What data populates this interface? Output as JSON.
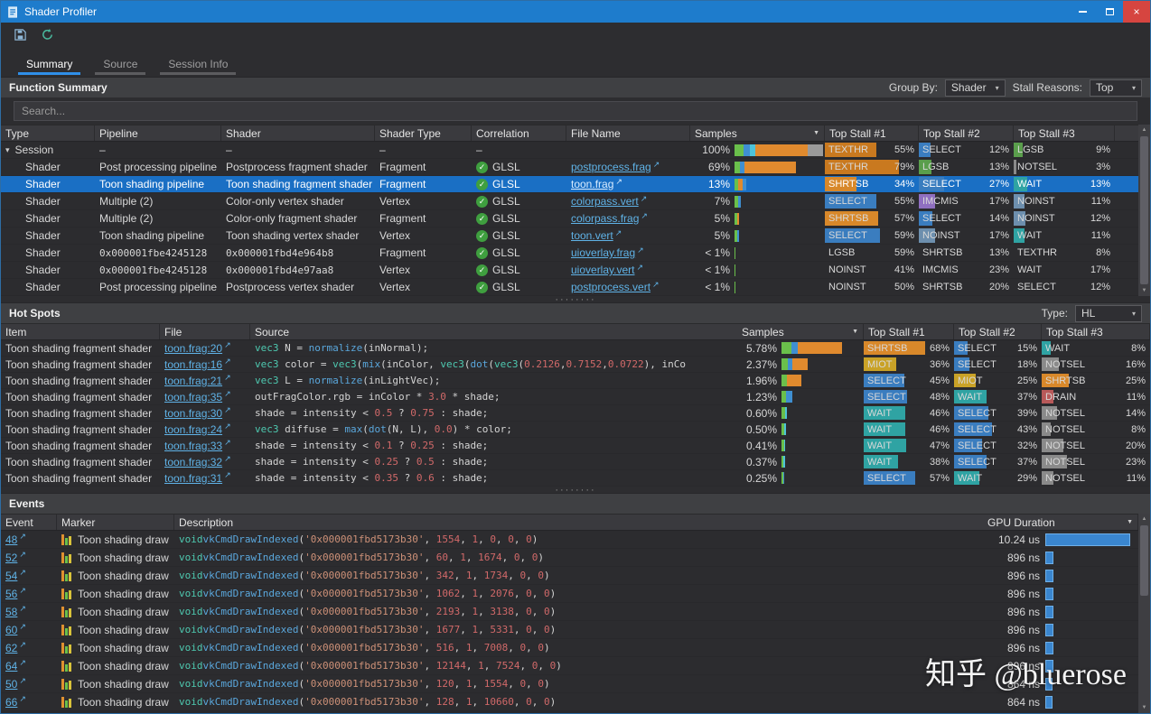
{
  "window": {
    "title": "Shader Profiler"
  },
  "icons": {
    "close": "×",
    "dropdown": "▾",
    "expander": "▾",
    "sort": "▼",
    "external": "↗",
    "check": "✓",
    "scroll_up": "▲",
    "scroll_down": "▼",
    "grip": "········"
  },
  "tabs": [
    {
      "label": "Summary"
    },
    {
      "label": "Source"
    },
    {
      "label": "Session Info"
    }
  ],
  "stall_colors": {
    "TEXTHR": "#c9791f",
    "SHRTSB": "#d8882a",
    "SELECT": "#3a7dbf",
    "LGSB": "#5a9e4c",
    "WAIT": "#2fa3a3",
    "MIOT": "#c9a227",
    "IMCMIS": "#8f6fc0",
    "NOINST": "#6d8fae",
    "NOTSEL": "#8a8a8a",
    "DRAIN": "#b85959"
  },
  "function_summary": {
    "title": "Function Summary",
    "group_by_label": "Group By:",
    "group_by_value": "Shader",
    "stall_reasons_label": "Stall Reasons:",
    "stall_reasons_value": "Top",
    "search_placeholder": "Search...",
    "columns": [
      "Type",
      "Pipeline",
      "Shader",
      "Shader Type",
      "Correlation",
      "File Name",
      "Samples",
      "Top Stall #1",
      "Top Stall #2",
      "Top Stall #3"
    ],
    "rows": [
      {
        "type": "Session",
        "expander": true,
        "pipeline": "–",
        "shader": "–",
        "shader_type": "–",
        "correlation": "–",
        "file": null,
        "samples": "100%",
        "bar": [
          [
            "#6abf4b",
            10
          ],
          [
            "#3f8fd1",
            7
          ],
          [
            "#4dc3d9",
            6
          ],
          [
            "#e08a2e",
            60
          ],
          [
            "#9a9a9a",
            17
          ]
        ],
        "stalls": [
          {
            "name": "TEXTHR",
            "pct": "55%",
            "w": 55
          },
          {
            "name": "SELECT",
            "pct": "12%",
            "w": 12
          },
          {
            "name": "LGSB",
            "pct": "9%",
            "w": 9
          }
        ]
      },
      {
        "type": "Shader",
        "pipeline": "Post processing pipeline",
        "shader": "Postprocess fragment shader",
        "shader_type": "Fragment",
        "correlation": "GLSL",
        "file": "postprocess.frag",
        "samples": "69%",
        "bar": [
          [
            "#6abf4b",
            6
          ],
          [
            "#3f8fd1",
            5
          ],
          [
            "#e08a2e",
            58
          ]
        ],
        "stalls": [
          {
            "name": "TEXTHR",
            "pct": "79%",
            "w": 79
          },
          {
            "name": "LGSB",
            "pct": "13%",
            "w": 13
          },
          {
            "name": "NOTSEL",
            "pct": "3%",
            "w": 3
          }
        ]
      },
      {
        "type": "Shader",
        "selected": true,
        "pipeline": "Toon shading pipeline",
        "shader": "Toon shading fragment shader",
        "shader_type": "Fragment",
        "correlation": "GLSL",
        "file": "toon.frag",
        "samples": "13%",
        "bar": [
          [
            "#6abf4b",
            4
          ],
          [
            "#e08a2e",
            5
          ],
          [
            "#3f8fd1",
            4
          ]
        ],
        "stalls": [
          {
            "name": "SHRTSB",
            "pct": "34%",
            "w": 34
          },
          {
            "name": "SELECT",
            "pct": "27%",
            "w": 27
          },
          {
            "name": "WAIT",
            "pct": "13%",
            "w": 13
          }
        ]
      },
      {
        "type": "Shader",
        "pipeline": "Multiple (2)",
        "shader": "Color-only vertex shader",
        "shader_type": "Vertex",
        "correlation": "GLSL",
        "file": "colorpass.vert",
        "samples": "7%",
        "bar": [
          [
            "#6abf4b",
            4
          ],
          [
            "#3f8fd1",
            3
          ]
        ],
        "stalls": [
          {
            "name": "SELECT",
            "pct": "55%",
            "w": 55
          },
          {
            "name": "IMCMIS",
            "pct": "17%",
            "w": 17
          },
          {
            "name": "NOINST",
            "pct": "11%",
            "w": 11
          }
        ]
      },
      {
        "type": "Shader",
        "pipeline": "Multiple (2)",
        "shader": "Color-only fragment shader",
        "shader_type": "Fragment",
        "correlation": "GLSL",
        "file": "colorpass.frag",
        "samples": "5%",
        "bar": [
          [
            "#6abf4b",
            3
          ],
          [
            "#e08a2e",
            2
          ]
        ],
        "stalls": [
          {
            "name": "SHRTSB",
            "pct": "57%",
            "w": 57
          },
          {
            "name": "SELECT",
            "pct": "14%",
            "w": 14
          },
          {
            "name": "NOINST",
            "pct": "12%",
            "w": 12
          }
        ]
      },
      {
        "type": "Shader",
        "pipeline": "Toon shading pipeline",
        "shader": "Toon shading vertex shader",
        "shader_type": "Vertex",
        "correlation": "GLSL",
        "file": "toon.vert",
        "samples": "5%",
        "bar": [
          [
            "#6abf4b",
            3
          ],
          [
            "#3f8fd1",
            2
          ]
        ],
        "stalls": [
          {
            "name": "SELECT",
            "pct": "59%",
            "w": 59
          },
          {
            "name": "NOINST",
            "pct": "17%",
            "w": 17
          },
          {
            "name": "WAIT",
            "pct": "11%",
            "w": 11
          }
        ]
      },
      {
        "type": "Shader",
        "pipeline": "0x000001fbe4245128",
        "shader": "0x000001fbd4e964b8",
        "shader_type": "Fragment",
        "correlation": "GLSL",
        "file": "uioverlay.frag",
        "samples": "< 1%",
        "bar": [
          [
            "#6abf4b",
            1
          ]
        ],
        "stalls": [
          {
            "name": "LGSB",
            "pct": "59%",
            "w": 0
          },
          {
            "name": "SHRTSB",
            "pct": "13%",
            "w": 0
          },
          {
            "name": "TEXTHR",
            "pct": "8%",
            "w": 0
          }
        ]
      },
      {
        "type": "Shader",
        "pipeline": "0x000001fbe4245128",
        "shader": "0x000001fbd4e97aa8",
        "shader_type": "Vertex",
        "correlation": "GLSL",
        "file": "uioverlay.vert",
        "samples": "< 1%",
        "bar": [
          [
            "#6abf4b",
            1
          ]
        ],
        "stalls": [
          {
            "name": "NOINST",
            "pct": "41%",
            "w": 0
          },
          {
            "name": "IMCMIS",
            "pct": "23%",
            "w": 0
          },
          {
            "name": "WAIT",
            "pct": "17%",
            "w": 0
          }
        ]
      },
      {
        "type": "Shader",
        "pipeline": "Post processing pipeline",
        "shader": "Postprocess vertex shader",
        "shader_type": "Vertex",
        "correlation": "GLSL",
        "file": "postprocess.vert",
        "samples": "< 1%",
        "bar": [
          [
            "#6abf4b",
            1
          ]
        ],
        "stalls": [
          {
            "name": "NOINST",
            "pct": "50%",
            "w": 0
          },
          {
            "name": "SHRTSB",
            "pct": "20%",
            "w": 0
          },
          {
            "name": "SELECT",
            "pct": "12%",
            "w": 0
          }
        ]
      }
    ]
  },
  "hot_spots": {
    "title": "Hot Spots",
    "type_label": "Type:",
    "type_value": "HL",
    "columns": [
      "Item",
      "File",
      "Source",
      "Samples",
      "Top Stall #1",
      "Top Stall #2",
      "Top Stall #3"
    ],
    "rows": [
      {
        "item": "Toon shading fragment shader",
        "file": "toon.frag:20",
        "source": "vec3 N = normalize(inNormal);",
        "samples": "5.78%",
        "bar": [
          [
            "#6abf4b",
            12
          ],
          [
            "#3f8fd1",
            8
          ],
          [
            "#e08a2e",
            55
          ]
        ],
        "stalls": [
          {
            "name": "SHRTSB",
            "pct": "68%",
            "w": 68
          },
          {
            "name": "SELECT",
            "pct": "15%",
            "w": 15
          },
          {
            "name": "WAIT",
            "pct": "8%",
            "w": 8
          }
        ]
      },
      {
        "item": "Toon shading fragment shader",
        "file": "toon.frag:16",
        "source": "vec3 color = vec3(mix(inColor, vec3(dot(vec3(0.2126,0.7152,0.0722), inCo",
        "samples": "2.37%",
        "bar": [
          [
            "#6abf4b",
            8
          ],
          [
            "#3f8fd1",
            5
          ],
          [
            "#e08a2e",
            20
          ]
        ],
        "stalls": [
          {
            "name": "MIOT",
            "pct": "36%",
            "w": 36
          },
          {
            "name": "SELECT",
            "pct": "18%",
            "w": 18
          },
          {
            "name": "NOTSEL",
            "pct": "16%",
            "w": 16
          }
        ]
      },
      {
        "item": "Toon shading fragment shader",
        "file": "toon.frag:21",
        "source": "vec3 L = normalize(inLightVec);",
        "samples": "1.96%",
        "bar": [
          [
            "#6abf4b",
            7
          ],
          [
            "#e08a2e",
            18
          ]
        ],
        "stalls": [
          {
            "name": "SELECT",
            "pct": "45%",
            "w": 45
          },
          {
            "name": "MIOT",
            "pct": "25%",
            "w": 25
          },
          {
            "name": "SHRTSB",
            "pct": "25%",
            "w": 25
          }
        ]
      },
      {
        "item": "Toon shading fragment shader",
        "file": "toon.frag:35",
        "source": "outFragColor.rgb = inColor * 3.0 * shade;",
        "samples": "1.23%",
        "bar": [
          [
            "#6abf4b",
            6
          ],
          [
            "#3f8fd1",
            8
          ]
        ],
        "stalls": [
          {
            "name": "SELECT",
            "pct": "48%",
            "w": 48
          },
          {
            "name": "WAIT",
            "pct": "37%",
            "w": 37
          },
          {
            "name": "DRAIN",
            "pct": "11%",
            "w": 11
          }
        ]
      },
      {
        "item": "Toon shading fragment shader",
        "file": "toon.frag:30",
        "source": "shade = intensity < 0.5 ? 0.75 : shade;",
        "samples": "0.60%",
        "bar": [
          [
            "#6abf4b",
            4
          ],
          [
            "#4dc3d9",
            3
          ]
        ],
        "stalls": [
          {
            "name": "WAIT",
            "pct": "46%",
            "w": 46
          },
          {
            "name": "SELECT",
            "pct": "39%",
            "w": 39
          },
          {
            "name": "NOTSEL",
            "pct": "14%",
            "w": 14
          }
        ]
      },
      {
        "item": "Toon shading fragment shader",
        "file": "toon.frag:24",
        "source": "vec3 diffuse = max(dot(N, L), 0.0) * color;",
        "samples": "0.50%",
        "bar": [
          [
            "#6abf4b",
            3
          ],
          [
            "#4dc3d9",
            3
          ]
        ],
        "stalls": [
          {
            "name": "WAIT",
            "pct": "46%",
            "w": 46
          },
          {
            "name": "SELECT",
            "pct": "43%",
            "w": 43
          },
          {
            "name": "NOTSEL",
            "pct": "8%",
            "w": 8
          }
        ]
      },
      {
        "item": "Toon shading fragment shader",
        "file": "toon.frag:33",
        "source": "shade = intensity < 0.1 ? 0.25 : shade;",
        "samples": "0.41%",
        "bar": [
          [
            "#6abf4b",
            3
          ],
          [
            "#4dc3d9",
            2
          ]
        ],
        "stalls": [
          {
            "name": "WAIT",
            "pct": "47%",
            "w": 47
          },
          {
            "name": "SELECT",
            "pct": "32%",
            "w": 32
          },
          {
            "name": "NOTSEL",
            "pct": "20%",
            "w": 20
          }
        ]
      },
      {
        "item": "Toon shading fragment shader",
        "file": "toon.frag:32",
        "source": "shade = intensity < 0.25 ? 0.5 : shade;",
        "samples": "0.37%",
        "bar": [
          [
            "#6abf4b",
            2
          ],
          [
            "#4dc3d9",
            2
          ]
        ],
        "stalls": [
          {
            "name": "WAIT",
            "pct": "38%",
            "w": 38
          },
          {
            "name": "SELECT",
            "pct": "37%",
            "w": 37
          },
          {
            "name": "NOTSEL",
            "pct": "23%",
            "w": 23
          }
        ]
      },
      {
        "item": "Toon shading fragment shader",
        "file": "toon.frag:31",
        "source": "shade = intensity < 0.35 ? 0.6 : shade;",
        "samples": "0.25%",
        "bar": [
          [
            "#6abf4b",
            2
          ],
          [
            "#3f8fd1",
            1
          ]
        ],
        "stalls": [
          {
            "name": "SELECT",
            "pct": "57%",
            "w": 57
          },
          {
            "name": "WAIT",
            "pct": "29%",
            "w": 29
          },
          {
            "name": "NOTSEL",
            "pct": "11%",
            "w": 11
          }
        ]
      }
    ]
  },
  "events": {
    "title": "Events",
    "columns": [
      "Event",
      "Marker",
      "Description",
      "GPU Duration"
    ],
    "marker_colors": [
      "#e0912f",
      "#6abf4b",
      "#d9c33a"
    ],
    "gpu_bar_color": "#3a86cf",
    "rows": [
      {
        "event": "48",
        "marker": "Toon shading draw",
        "description": "void vkCmdDrawIndexed('0x000001fbd5173b30', 1554, 1, 0, 0, 0)",
        "duration": "10.24 us",
        "bar": 96
      },
      {
        "event": "52",
        "marker": "Toon shading draw",
        "description": "void vkCmdDrawIndexed('0x000001fbd5173b30', 60, 1, 1674, 0, 0)",
        "duration": "896 ns",
        "bar": 9
      },
      {
        "event": "54",
        "marker": "Toon shading draw",
        "description": "void vkCmdDrawIndexed('0x000001fbd5173b30', 342, 1, 1734, 0, 0)",
        "duration": "896 ns",
        "bar": 9
      },
      {
        "event": "56",
        "marker": "Toon shading draw",
        "description": "void vkCmdDrawIndexed('0x000001fbd5173b30', 1062, 1, 2076, 0, 0)",
        "duration": "896 ns",
        "bar": 9
      },
      {
        "event": "58",
        "marker": "Toon shading draw",
        "description": "void vkCmdDrawIndexed('0x000001fbd5173b30', 2193, 1, 3138, 0, 0)",
        "duration": "896 ns",
        "bar": 9
      },
      {
        "event": "60",
        "marker": "Toon shading draw",
        "description": "void vkCmdDrawIndexed('0x000001fbd5173b30', 1677, 1, 5331, 0, 0)",
        "duration": "896 ns",
        "bar": 9
      },
      {
        "event": "62",
        "marker": "Toon shading draw",
        "description": "void vkCmdDrawIndexed('0x000001fbd5173b30', 516, 1, 7008, 0, 0)",
        "duration": "896 ns",
        "bar": 9
      },
      {
        "event": "64",
        "marker": "Toon shading draw",
        "description": "void vkCmdDrawIndexed('0x000001fbd5173b30', 12144, 1, 7524, 0, 0)",
        "duration": "896 ns",
        "bar": 9
      },
      {
        "event": "50",
        "marker": "Toon shading draw",
        "description": "void vkCmdDrawIndexed('0x000001fbd5173b30', 120, 1, 1554, 0, 0)",
        "duration": "864 ns",
        "bar": 8
      },
      {
        "event": "66",
        "marker": "Toon shading draw",
        "description": "void vkCmdDrawIndexed('0x000001fbd5173b30', 128, 1, 10660, 0, 0)",
        "duration": "864 ns",
        "bar": 8
      }
    ]
  },
  "watermark": {
    "text": "知乎 @bluerose"
  }
}
